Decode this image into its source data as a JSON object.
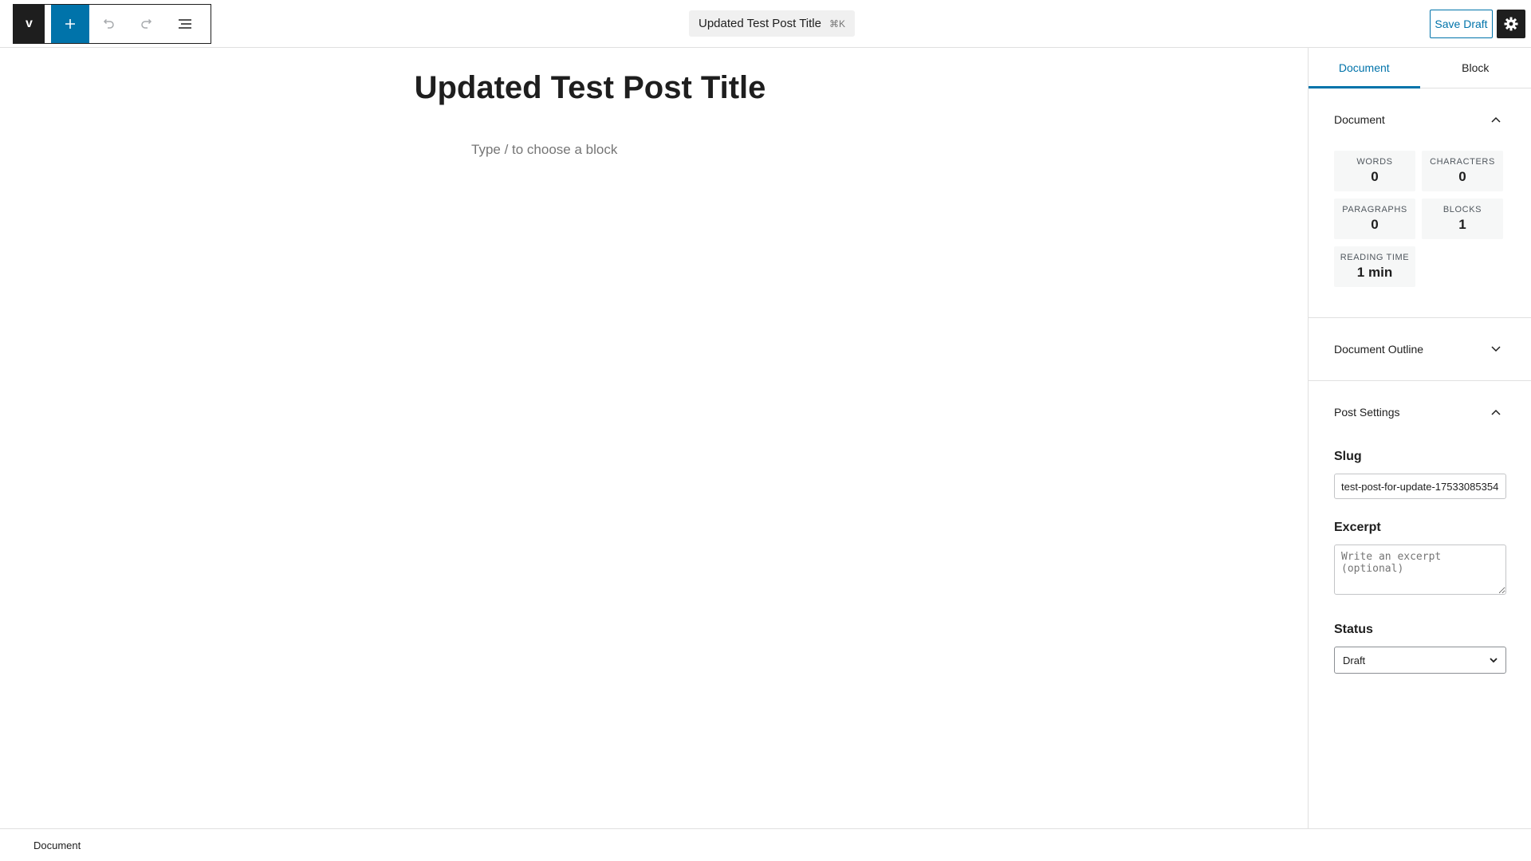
{
  "toolbar": {
    "logo_label": "v",
    "icons": {
      "add": "plus-icon",
      "undo": "undo-icon",
      "redo": "redo-icon",
      "list_view": "list-view-icon",
      "settings": "gear-icon"
    },
    "document_title": "Updated Test Post Title",
    "shortcut": "⌘K",
    "save_draft_label": "Save Draft"
  },
  "editor": {
    "post_title": "Updated Test Post Title",
    "block_placeholder": "Type / to choose a block"
  },
  "sidebar": {
    "tabs": [
      {
        "label": "Document",
        "active": true
      },
      {
        "label": "Block",
        "active": false
      }
    ],
    "document_panel": {
      "title": "Document",
      "stats": [
        {
          "label": "WORDS",
          "value": "0"
        },
        {
          "label": "CHARACTERS",
          "value": "0"
        },
        {
          "label": "PARAGRAPHS",
          "value": "0"
        },
        {
          "label": "BLOCKS",
          "value": "1"
        },
        {
          "label": "READING TIME",
          "value": "1 min"
        }
      ]
    },
    "outline_panel": {
      "title": "Document Outline"
    },
    "post_settings": {
      "title": "Post Settings",
      "slug_label": "Slug",
      "slug_value": "test-post-for-update-17533085354",
      "excerpt_label": "Excerpt",
      "excerpt_placeholder": "Write an excerpt (optional)",
      "status_label": "Status",
      "status_value": "Draft"
    }
  },
  "footer": {
    "breadcrumb": "Document"
  },
  "colors": {
    "accent": "#0073aa",
    "dark": "#1e1e1e",
    "border": "#e0e0e0"
  }
}
